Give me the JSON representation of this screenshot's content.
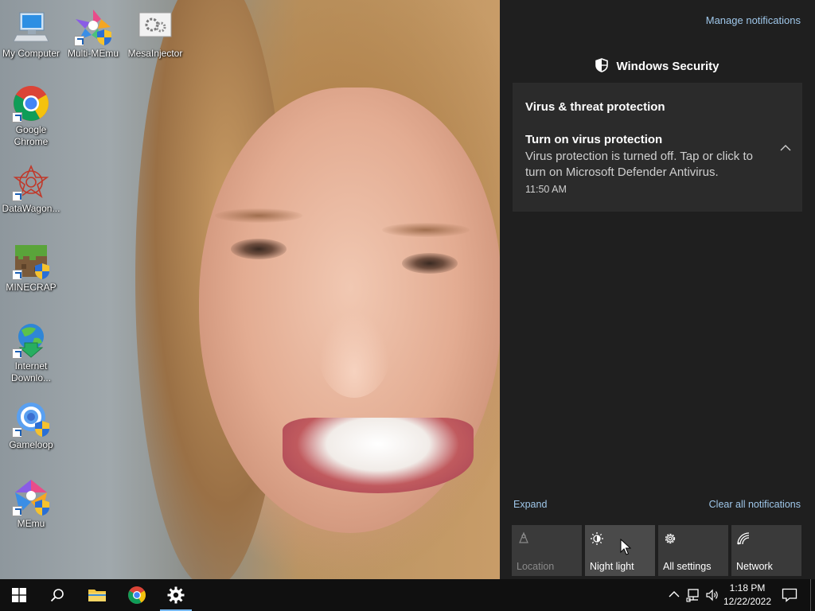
{
  "desktop": {
    "icons": [
      {
        "label": "My Computer",
        "icon": "computer-icon"
      },
      {
        "label": "Multi-MEmu",
        "icon": "multi-memu-icon"
      },
      {
        "label": "MesaInjector",
        "icon": "gears-icon"
      },
      {
        "label": "Google Chrome",
        "icon": "chrome-icon"
      },
      {
        "label": "DataWagon...",
        "icon": "datawagon-icon"
      },
      {
        "label": "MINECRAP",
        "icon": "minecraft-block-icon"
      },
      {
        "label": "Internet Downlo...",
        "icon": "internet-download-manager-icon"
      },
      {
        "label": "Gameloop",
        "icon": "gameloop-icon"
      },
      {
        "label": "MEmu",
        "icon": "memu-icon"
      }
    ]
  },
  "action_center": {
    "manage_notifications": "Manage notifications",
    "app_name": "Windows Security",
    "notification": {
      "category": "Virus & threat protection",
      "title": "Turn on virus protection",
      "body": "Virus protection is turned off. Tap or click to turn on Microsoft Defender Antivirus.",
      "time": "11:50 AM"
    },
    "expand_label": "Expand",
    "clear_all_label": "Clear all notifications",
    "quick_actions": [
      {
        "label": "Location",
        "icon": "location-icon",
        "state": "disabled"
      },
      {
        "label": "Night light",
        "icon": "brightness-icon",
        "state": "hover"
      },
      {
        "label": "All settings",
        "icon": "gear-icon",
        "state": "normal"
      },
      {
        "label": "Network",
        "icon": "network-icon",
        "state": "normal"
      }
    ]
  },
  "taskbar": {
    "items": [
      {
        "name": "start-button",
        "icon": "windows-logo-icon"
      },
      {
        "name": "search-button",
        "icon": "search-icon"
      },
      {
        "name": "file-explorer",
        "icon": "folder-icon"
      },
      {
        "name": "chrome",
        "icon": "chrome-icon"
      },
      {
        "name": "settings",
        "icon": "gear-icon",
        "active": true
      }
    ],
    "clock": {
      "time": "1:18 PM",
      "date": "12/22/2022"
    },
    "tray_icons": [
      "chevron-up-icon",
      "network-wired-icon",
      "volume-icon"
    ]
  },
  "colors": {
    "action_center_bg": "#1f1f1f",
    "card_bg": "#2b2b2b",
    "link": "#9fc7ea",
    "tile_bg": "#3a3a3a",
    "taskbar_bg": "#101010",
    "accent": "#77b8f0"
  }
}
